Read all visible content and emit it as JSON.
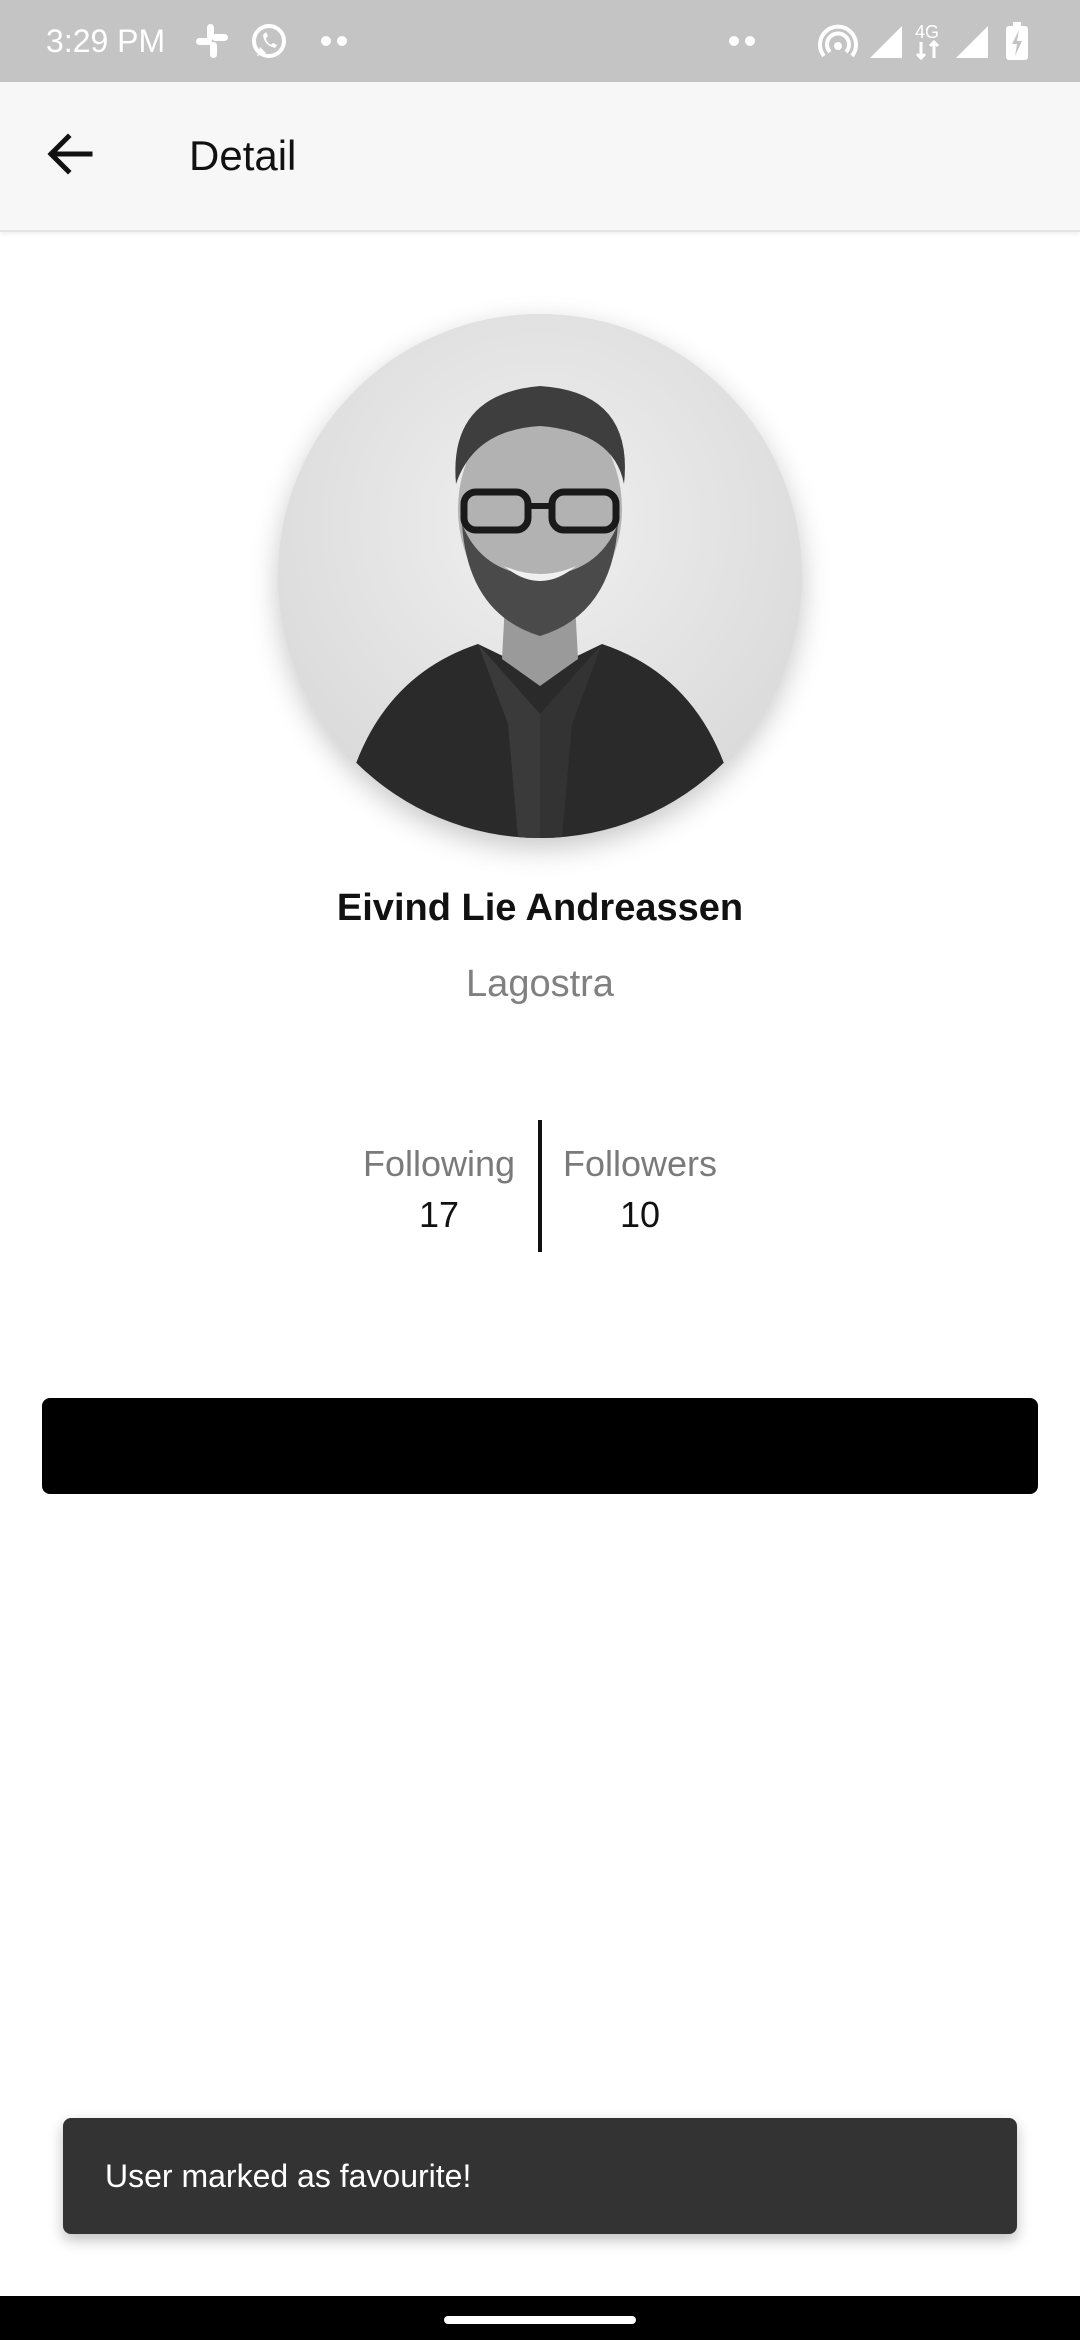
{
  "status_bar": {
    "time": "3:29 PM",
    "left_icons": [
      "slack-icon",
      "whatsapp-icon",
      "more-notifications-icon"
    ],
    "right_icons": [
      "more-notifications-icon",
      "hotspot-icon",
      "signal-icon",
      "4g-icon",
      "signal-icon",
      "battery-charging-icon"
    ],
    "network_label": "4G"
  },
  "app_bar": {
    "back_icon": "arrow-back-icon",
    "title": "Detail"
  },
  "profile": {
    "avatar_icon": "user-photo",
    "name": "Eivind Lie Andreassen",
    "company": "Lagostra"
  },
  "stats": {
    "following_label": "Following",
    "following_value": "17",
    "followers_label": "Followers",
    "followers_value": "10"
  },
  "action_button": {
    "label": ""
  },
  "snackbar": {
    "message": "User marked as favourite!"
  },
  "colors": {
    "status_bar_bg": "#c4c4c4",
    "app_bar_bg": "#f7f7f7",
    "button_bg": "#000000",
    "snackbar_bg": "#333333",
    "secondary_text": "#808080"
  }
}
